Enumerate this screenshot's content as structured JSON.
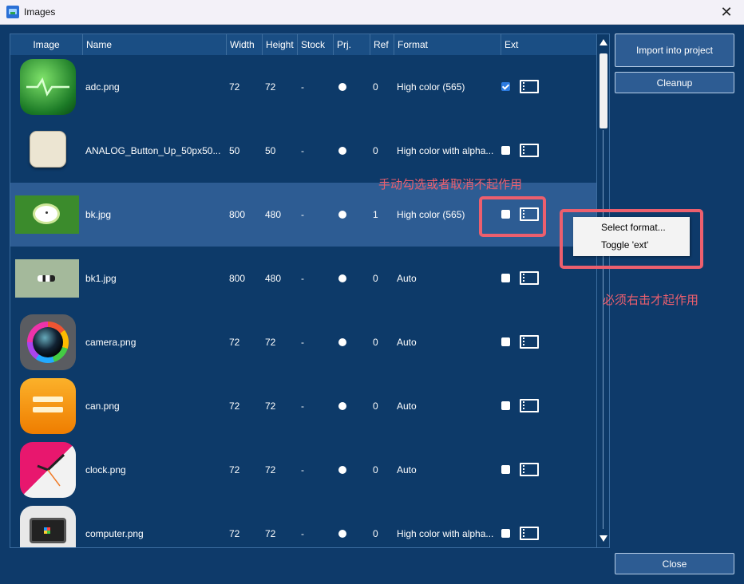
{
  "window": {
    "title": "Images",
    "close_glyph": "✕"
  },
  "columns": [
    "Image",
    "Name",
    "Width",
    "Height",
    "Stock",
    "Prj.",
    "Ref",
    "Format",
    "Ext"
  ],
  "rows": [
    {
      "name": "adc.png",
      "width": "72",
      "height": "72",
      "stock": "-",
      "ref": "0",
      "format": "High color (565)",
      "ext": true
    },
    {
      "name": "ANALOG_Button_Up_50px50...",
      "width": "50",
      "height": "50",
      "stock": "-",
      "ref": "0",
      "format": "High color with alpha...",
      "ext": false
    },
    {
      "name": "bk.jpg",
      "width": "800",
      "height": "480",
      "stock": "-",
      "ref": "1",
      "format": "High color (565)",
      "ext": false,
      "selected": true
    },
    {
      "name": "bk1.jpg",
      "width": "800",
      "height": "480",
      "stock": "-",
      "ref": "0",
      "format": "Auto",
      "ext": false
    },
    {
      "name": "camera.png",
      "width": "72",
      "height": "72",
      "stock": "-",
      "ref": "0",
      "format": "Auto",
      "ext": false
    },
    {
      "name": "can.png",
      "width": "72",
      "height": "72",
      "stock": "-",
      "ref": "0",
      "format": "Auto",
      "ext": false
    },
    {
      "name": "clock.png",
      "width": "72",
      "height": "72",
      "stock": "-",
      "ref": "0",
      "format": "Auto",
      "ext": false
    },
    {
      "name": "computer.png",
      "width": "72",
      "height": "72",
      "stock": "-",
      "ref": "0",
      "format": "High color with alpha...",
      "ext": false
    }
  ],
  "buttons": {
    "import": "Import into project",
    "cleanup": "Cleanup",
    "close": "Close"
  },
  "context_menu": [
    "Select format...",
    "Toggle 'ext'"
  ],
  "annotations": {
    "manual": "手动勾选或者取消不起作用",
    "rightclick": "必须右击才起作用"
  },
  "colors": {
    "background": "#0e3a6a",
    "selected_row": "#2d5c93",
    "annotation": "#ec5f6e"
  }
}
